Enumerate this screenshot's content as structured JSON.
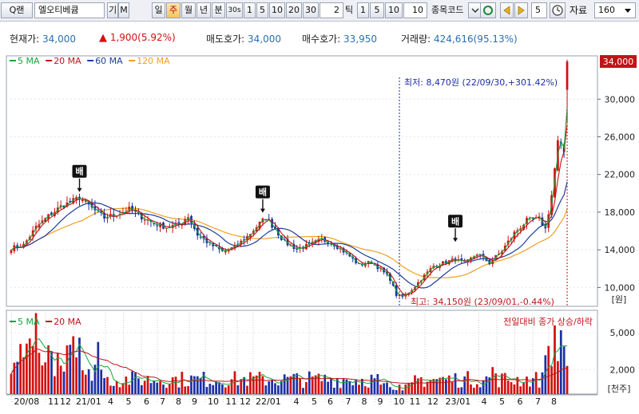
{
  "toolbar": {
    "search_btn": "Q랜",
    "stock_name": "엘오티베큠",
    "btn_gi": "기",
    "btn_m": "M",
    "period_day": "일",
    "period_week": "주",
    "period_month": "월",
    "period_year": "년",
    "period_min": "분",
    "sec30": "30s",
    "n1": "1",
    "n5": "5",
    "n10": "10",
    "n20": "20",
    "n30": "30",
    "tick_count": "2",
    "tick_label": "틱",
    "t1": "1",
    "t5": "5",
    "t10": "10",
    "t10b": "10",
    "code_label": "종목코드",
    "step_value": "5",
    "data_label": "자료",
    "data_count": "160"
  },
  "info": {
    "price_label": "현재가:",
    "price_value": "34,000",
    "change_arrow": "▲",
    "change_value": "1,900(5.92%)",
    "ask_label": "매도호가:",
    "ask_value": "34,000",
    "bid_label": "매수호가:",
    "bid_value": "33,950",
    "volume_label": "거래량:",
    "volume_value": "424,616(95.13%)"
  },
  "chart_data": [
    {
      "type": "candlestick",
      "title": "",
      "legend": [
        {
          "name": "5 MA",
          "color": "#16a63a"
        },
        {
          "name": "20 MA",
          "color": "#c0141a"
        },
        {
          "name": "60 MA",
          "color": "#1c3f9a"
        },
        {
          "name": "120 MA",
          "color": "#f0a020"
        }
      ],
      "y_ticks": [
        "10,000",
        "14,000",
        "18,000",
        "22,000",
        "26,000",
        "30,000"
      ],
      "y_tick_values": [
        10000,
        14000,
        18000,
        22000,
        26000,
        30000
      ],
      "ylim": [
        8000,
        34600
      ],
      "y_unit": "[원]",
      "current_price_label": "34,000",
      "current_price": 34000,
      "high_annotation": "최저: 8,470원 (22/09/30,+301.42%)",
      "low_annotation": "최고: 34,150원 (23/09/01,-0.44%)",
      "signal_label": "배",
      "signals": [
        {
          "index": 22,
          "price": 19800
        },
        {
          "index": 81,
          "price": 17600
        },
        {
          "index": 143,
          "price": 14500
        }
      ],
      "weeks": 180,
      "anchors": [
        [
          0,
          14200
        ],
        [
          4,
          14500
        ],
        [
          8,
          16400
        ],
        [
          12,
          17600
        ],
        [
          16,
          18600
        ],
        [
          20,
          19200
        ],
        [
          22,
          19600
        ],
        [
          26,
          18400
        ],
        [
          30,
          17400
        ],
        [
          34,
          17800
        ],
        [
          38,
          18300
        ],
        [
          42,
          17500
        ],
        [
          46,
          16800
        ],
        [
          50,
          16400
        ],
        [
          54,
          16700
        ],
        [
          57,
          17600
        ],
        [
          60,
          15600
        ],
        [
          64,
          14600
        ],
        [
          68,
          13800
        ],
        [
          72,
          14300
        ],
        [
          76,
          15400
        ],
        [
          80,
          16800
        ],
        [
          82,
          17400
        ],
        [
          85,
          16200
        ],
        [
          88,
          14800
        ],
        [
          92,
          14100
        ],
        [
          96,
          14500
        ],
        [
          100,
          15100
        ],
        [
          104,
          14600
        ],
        [
          108,
          13600
        ],
        [
          112,
          12400
        ],
        [
          116,
          12700
        ],
        [
          119,
          11900
        ],
        [
          122,
          10900
        ],
        [
          124,
          9200
        ],
        [
          126,
          9000
        ],
        [
          129,
          9800
        ],
        [
          132,
          10900
        ],
        [
          136,
          12300
        ],
        [
          140,
          12700
        ],
        [
          143,
          13000
        ],
        [
          146,
          12500
        ],
        [
          150,
          13600
        ],
        [
          154,
          12600
        ],
        [
          158,
          13900
        ],
        [
          162,
          15800
        ],
        [
          166,
          17100
        ],
        [
          170,
          17300
        ],
        [
          172,
          16200
        ],
        [
          174,
          19800
        ],
        [
          176,
          25400
        ],
        [
          178,
          24400
        ],
        [
          179,
          27000
        ]
      ],
      "final_spike": {
        "open": 31000,
        "high": 34200,
        "low": 27500,
        "close": 34000
      }
    },
    {
      "type": "bar",
      "title": "",
      "legend": [
        {
          "name": "5 MA",
          "color": "#16a63a"
        },
        {
          "name": "20 MA",
          "color": "#c0141a"
        }
      ],
      "right_label": "전일대비 종가 상승/하락",
      "y_ticks": [
        "2,000",
        "5,000"
      ],
      "y_tick_values": [
        2000,
        5000
      ],
      "ylim": [
        0,
        6700
      ],
      "y_unit": "[천주]",
      "up_color": "#d51010",
      "down_color": "#1c2fa6"
    }
  ],
  "x_axis": {
    "labels": [
      "20/08",
      "11",
      "12",
      "21/01",
      "4",
      "5",
      "6",
      "7",
      "8",
      "9",
      "10",
      "11",
      "12",
      "22/01",
      "4",
      "5",
      "6",
      "7",
      "8",
      "9",
      "10",
      "11",
      "12",
      "23/01",
      "4",
      "5",
      "6",
      "7",
      "8"
    ],
    "label_weeks": [
      1,
      18,
      24,
      32,
      48,
      57,
      66,
      74,
      82,
      90,
      98,
      107,
      114,
      122,
      141,
      150,
      158,
      167,
      175,
      183,
      191,
      199,
      208,
      217,
      235,
      244,
      253,
      262,
      270
    ]
  }
}
